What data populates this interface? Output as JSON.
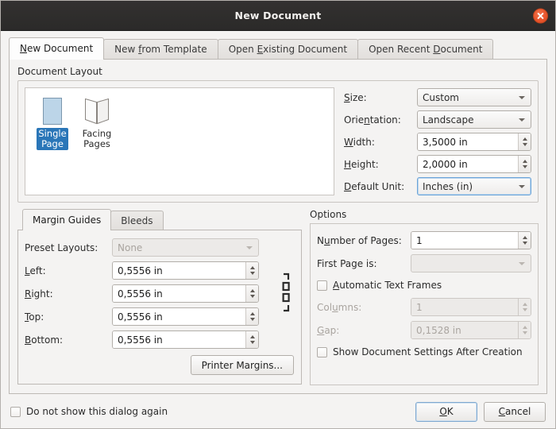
{
  "window": {
    "title": "New Document",
    "close_icon": "close-icon"
  },
  "tabs": [
    {
      "label": "New Document",
      "mnemonic": "N",
      "active": true
    },
    {
      "label": "New from Template",
      "mnemonic": "f",
      "active": false
    },
    {
      "label": "Open Existing Document",
      "mnemonic": "E",
      "active": false
    },
    {
      "label": "Open Recent Document",
      "mnemonic": "D",
      "active": false
    }
  ],
  "document_layout": {
    "title": "Document Layout",
    "page_types": [
      {
        "label_line1": "Single",
        "label_line2": "Page",
        "icon": "single-page-icon",
        "selected": true
      },
      {
        "label_line1": "Facing",
        "label_line2": "Pages",
        "icon": "facing-pages-icon",
        "selected": false
      }
    ],
    "fields": {
      "size_label": "Size:",
      "size_value": "Custom",
      "orientation_label": "Orientation:",
      "orientation_value": "Landscape",
      "width_label": "Width:",
      "width_value": "3,5000 in",
      "height_label": "Height:",
      "height_value": "2,0000 in",
      "default_unit_label": "Default Unit:",
      "default_unit_value": "Inches (in)"
    }
  },
  "margins": {
    "tabs": [
      {
        "label": "Margin Guides",
        "active": true
      },
      {
        "label": "Bleeds",
        "active": false
      }
    ],
    "preset_label": "Preset Layouts:",
    "preset_value": "None",
    "left_label": "Left:",
    "left_value": "0,5556 in",
    "right_label": "Right:",
    "right_value": "0,5556 in",
    "top_label": "Top:",
    "top_value": "0,5556 in",
    "bottom_label": "Bottom:",
    "bottom_value": "0,5556 in",
    "printer_margins_label": "Printer Margins...",
    "chain_icon": "chain-link-icon"
  },
  "options": {
    "title": "Options",
    "number_of_pages_label": "Number of Pages:",
    "number_of_pages_value": "1",
    "first_page_label": "First Page is:",
    "first_page_value": "",
    "automatic_text_frames_label": "Automatic Text Frames",
    "automatic_text_frames_checked": false,
    "columns_label": "Columns:",
    "columns_value": "1",
    "gap_label": "Gap:",
    "gap_value": "0,1528 in",
    "show_settings_label": "Show Document Settings After Creation",
    "show_settings_checked": false
  },
  "footer": {
    "dont_show_label": "Do not show this dialog again",
    "dont_show_checked": false,
    "ok_label": "OK",
    "cancel_label": "Cancel"
  },
  "colors": {
    "titlebar": "#2d2d2d",
    "close_button": "#e8542b",
    "selection": "#2a76b8",
    "focus_border": "#6ba4d8",
    "dialog_bg": "#f4f3f2"
  }
}
